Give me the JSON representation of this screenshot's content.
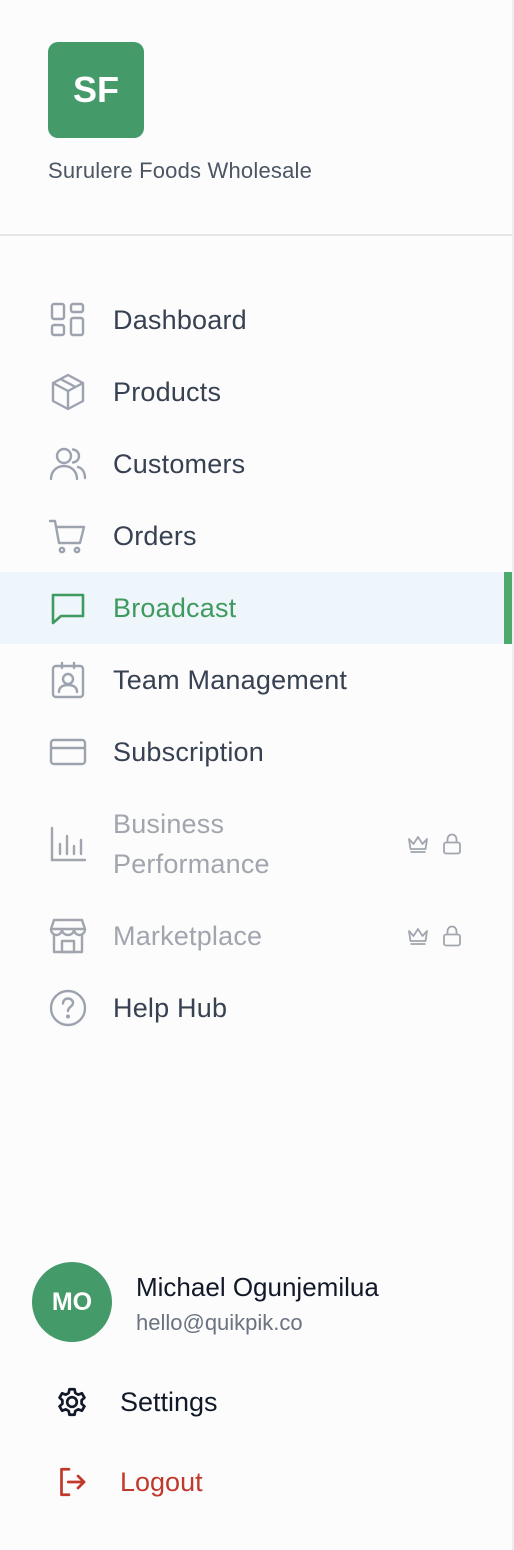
{
  "brand": {
    "initials": "SF",
    "name": "Surulere Foods Wholesale",
    "color": "#449a68"
  },
  "nav": {
    "items": [
      {
        "label": "Dashboard",
        "icon": "grid-icon"
      },
      {
        "label": "Products",
        "icon": "box-icon"
      },
      {
        "label": "Customers",
        "icon": "users-icon"
      },
      {
        "label": "Orders",
        "icon": "cart-icon"
      },
      {
        "label": "Broadcast",
        "icon": "message-icon",
        "active": true
      },
      {
        "label": "Team Management",
        "icon": "id-badge-icon"
      },
      {
        "label": "Subscription",
        "icon": "credit-card-icon"
      },
      {
        "label": "Business Performance",
        "label_line1": "Business",
        "label_line2": "Performance",
        "icon": "bar-chart-icon",
        "locked": true,
        "premium": true
      },
      {
        "label": "Marketplace",
        "icon": "store-icon",
        "locked": true,
        "premium": true
      },
      {
        "label": "Help Hub",
        "icon": "help-circle-icon"
      }
    ]
  },
  "user": {
    "initials": "MO",
    "name": "Michael Ogunjemilua",
    "email": "hello@quikpik.co"
  },
  "footer": {
    "settings_label": "Settings",
    "logout_label": "Logout"
  },
  "colors": {
    "active_text": "#3f9a5f",
    "active_bg": "#eef5fb",
    "logout": "#c0392b",
    "muted": "#a1a5ad"
  }
}
